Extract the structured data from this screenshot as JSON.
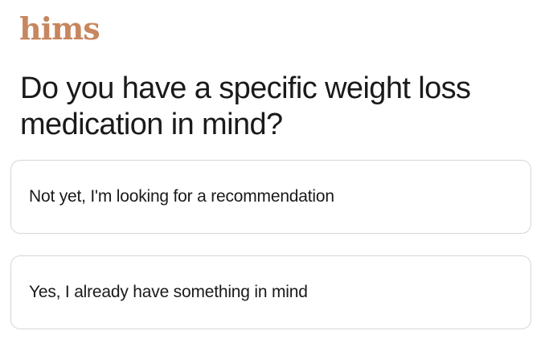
{
  "brand": {
    "logo_text": "hims",
    "logo_color": "#c7865f"
  },
  "question": {
    "title": "Do you have a specific weight loss medication in mind?"
  },
  "options": [
    {
      "label": "Not yet, I'm looking for a recommendation"
    },
    {
      "label": "Yes, I already have something in mind"
    }
  ]
}
